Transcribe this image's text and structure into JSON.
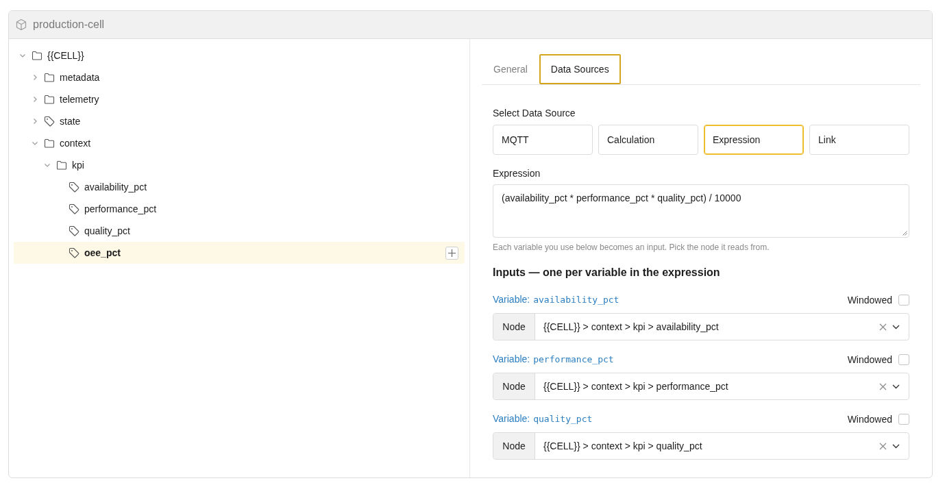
{
  "window": {
    "title": "production-cell"
  },
  "tree": [
    {
      "label": "{{CELL}}",
      "kind": "folder",
      "expanded": true,
      "selected": false,
      "children": [
        {
          "label": "metadata",
          "kind": "folder",
          "expanded": false,
          "selected": false
        },
        {
          "label": "telemetry",
          "kind": "folder",
          "expanded": false,
          "selected": false
        },
        {
          "label": "state",
          "kind": "tag",
          "expanded": false,
          "selected": false
        },
        {
          "label": "context",
          "kind": "folder",
          "expanded": true,
          "selected": false,
          "children": [
            {
              "label": "kpi",
              "kind": "folder",
              "expanded": true,
              "selected": false,
              "children": [
                {
                  "label": "availability_pct",
                  "kind": "tag",
                  "selected": false
                },
                {
                  "label": "performance_pct",
                  "kind": "tag",
                  "selected": false
                },
                {
                  "label": "quality_pct",
                  "kind": "tag",
                  "selected": false
                },
                {
                  "label": "oee_pct",
                  "kind": "tag",
                  "selected": true
                }
              ]
            }
          ]
        }
      ]
    }
  ],
  "tabs": [
    {
      "label": "General",
      "selected": false
    },
    {
      "label": "Data Sources",
      "selected": true
    }
  ],
  "data_source": {
    "label": "Select Data Source",
    "options": [
      {
        "label": "MQTT",
        "selected": false
      },
      {
        "label": "Calculation",
        "selected": false
      },
      {
        "label": "Expression",
        "selected": true
      },
      {
        "label": "Link",
        "selected": false
      }
    ]
  },
  "expression": {
    "label": "Expression",
    "value": "(availability_pct * performance_pct * quality_pct) / 10000",
    "hint": "Each variable you use below becomes an input. Pick the node it reads from."
  },
  "inputs": {
    "heading": "Inputs — one per variable in the expression",
    "items": [
      {
        "prefix": "Variable:",
        "variable": "availability_pct",
        "windowed_label": "Windowed",
        "windowed": false,
        "addon": "Node",
        "value": "{{CELL}} > context > kpi > availability_pct"
      },
      {
        "prefix": "Variable:",
        "variable": "performance_pct",
        "windowed_label": "Windowed",
        "windowed": false,
        "addon": "Node",
        "value": "{{CELL}} > context > kpi > performance_pct"
      },
      {
        "prefix": "Variable:",
        "variable": "quality_pct",
        "windowed_label": "Windowed",
        "windowed": false,
        "addon": "Node",
        "value": "{{CELL}} > context > kpi > quality_pct"
      }
    ]
  }
}
